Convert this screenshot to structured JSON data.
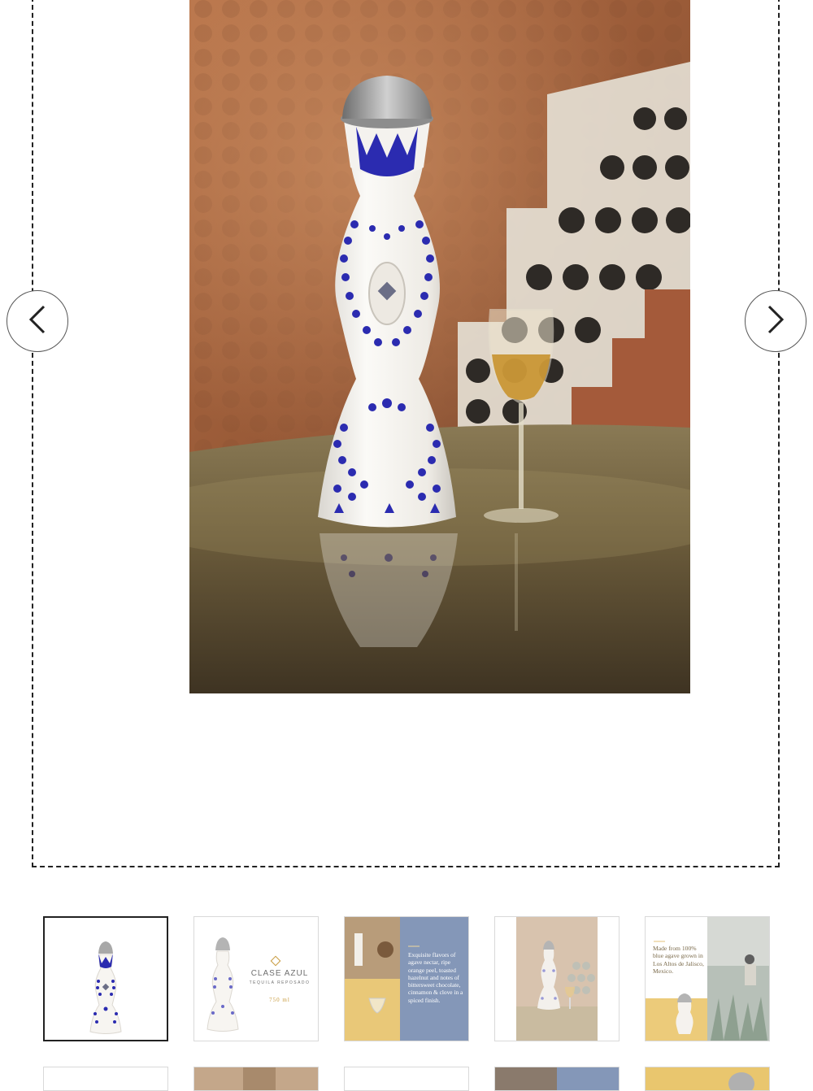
{
  "gallery": {
    "prev_icon": "chevron-left-icon",
    "next_icon": "chevron-right-icon",
    "selected_index": 0,
    "thumbnails": [
      {
        "name": "bottle-front"
      },
      {
        "name": "bottle-brand-card",
        "brand": "CLASE AZUL",
        "subtitle": "TEQUILA REPOSADO",
        "volume": "750 ml"
      },
      {
        "name": "tasting-notes-card",
        "text": "Exquisite flavors of agave nectar, ripe orange peel, toasted hazelnut and notes of bittersweet chocolate, cinnamon & clove in a spiced finish."
      },
      {
        "name": "bottle-lifestyle"
      },
      {
        "name": "origin-card",
        "text": "Made from 100% blue agave grown in Los Altos de Jalisco, Mexico."
      }
    ]
  },
  "colors": {
    "cobalt": "#2b2bb0",
    "card_blue": "#8497b8",
    "copper_wall": "#a0623c"
  }
}
